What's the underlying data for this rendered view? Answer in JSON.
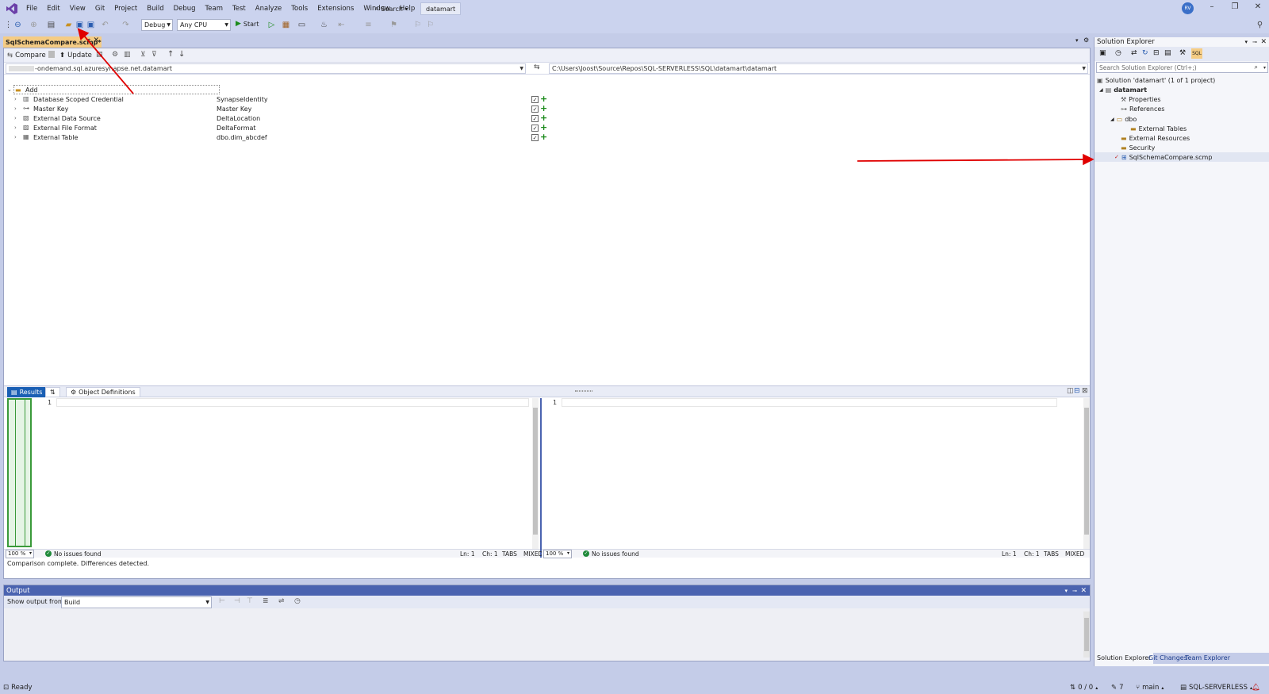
{
  "menubar": {
    "items": [
      "File",
      "Edit",
      "View",
      "Git",
      "Project",
      "Build",
      "Debug",
      "Team",
      "Test",
      "Analyze",
      "Tools",
      "Extensions",
      "Window",
      "Help"
    ],
    "search_label": "Search",
    "solution_name": "datamart",
    "avatar_initials": "RV"
  },
  "toolbar": {
    "configuration": "Debug",
    "platform": "Any CPU",
    "start_label": "Start"
  },
  "document": {
    "tab_title": "SqlSchemaCompare.scmp*"
  },
  "compare": {
    "compare_label": "Compare",
    "update_label": "Update",
    "source_path": "-ondemand.sql.azuresynapse.net.datamart",
    "target_path": "C:\\Users\\Joost\\Source\\Repos\\SQL-SERVERLESS\\SQL\\datamart\\datamart",
    "group_label": "Add",
    "rows": [
      {
        "type": "Database Scoped Credential",
        "source": "SynapseIdentity",
        "icon": "credential-icon"
      },
      {
        "type": "Master Key",
        "source": "Master Key",
        "icon": "key-icon"
      },
      {
        "type": "External Data Source",
        "source": "DeltaLocation",
        "icon": "datasource-icon"
      },
      {
        "type": "External File Format",
        "source": "DeltaFormat",
        "icon": "fileformat-icon"
      },
      {
        "type": "External Table",
        "source": "dbo.dim_abcdef",
        "icon": "table-icon"
      }
    ]
  },
  "results": {
    "tab_results": "Results",
    "tab_objdef": "Object Definitions",
    "left_line": "1",
    "right_line": "1",
    "zoom": "100 %",
    "issues": "No issues found",
    "ln": "Ln: 1",
    "ch": "Ch: 1",
    "tabs": "TABS",
    "mixed": "MIXED",
    "status": "Comparison complete.  Differences detected."
  },
  "output": {
    "title": "Output",
    "show_from_label": "Show output from:",
    "source": "Build"
  },
  "solution_explorer": {
    "title": "Solution Explorer",
    "search_placeholder": "Search Solution Explorer (Ctrl+;)",
    "solution_label": "Solution 'datamart' (1 of 1 project)",
    "project": "datamart",
    "properties": "Properties",
    "references": "References",
    "dbo": "dbo",
    "external_tables": "External Tables",
    "external_resources": "External Resources",
    "security": "Security",
    "scmp_file": "SqlSchemaCompare.scmp",
    "tabs": [
      "Solution Explorer",
      "Git Changes",
      "Team Explorer"
    ]
  },
  "statusbar": {
    "ready": "Ready",
    "changes": "0 / 0",
    "pencil": "7",
    "branch": "main",
    "repo": "SQL-SERVERLESS"
  },
  "colors": {
    "accent": "#1a5fb4",
    "tab_highlight": "#f5cc84",
    "annotation": "#e00000"
  }
}
